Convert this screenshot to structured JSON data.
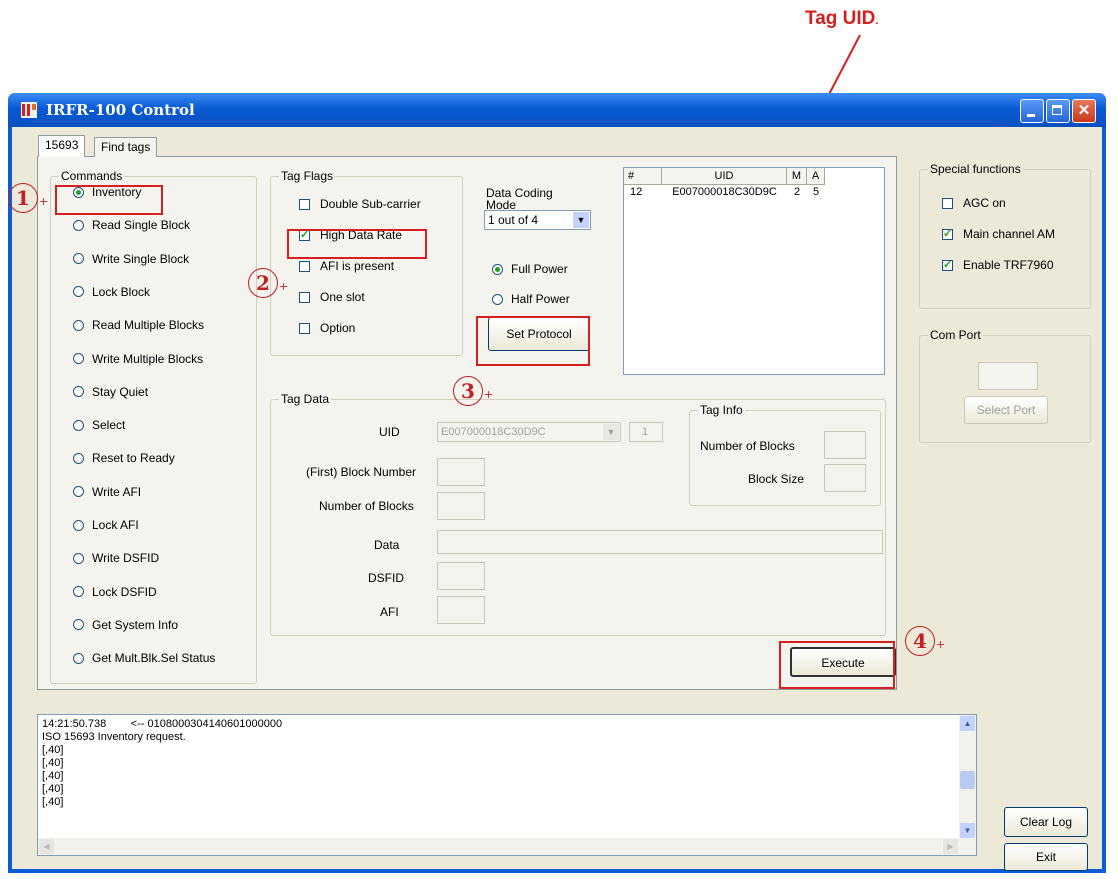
{
  "annotation": {
    "tag_uid_label": "Tag UID",
    "tag_uid_suffix": ".",
    "steps": [
      "1",
      "2",
      "3",
      "4"
    ],
    "step_mark": "+"
  },
  "window": {
    "title": "IRFR-100 Control"
  },
  "tabs": [
    {
      "label": "15693",
      "active": true
    },
    {
      "label": "Find tags",
      "active": false
    }
  ],
  "commands": {
    "legend": "Commands",
    "items": [
      {
        "label": "Inventory",
        "selected": true
      },
      {
        "label": "Read Single Block"
      },
      {
        "label": "Write Single Block"
      },
      {
        "label": "Lock Block"
      },
      {
        "label": "Read Multiple Blocks"
      },
      {
        "label": "Write Multiple Blocks"
      },
      {
        "label": "Stay Quiet"
      },
      {
        "label": "Select"
      },
      {
        "label": "Reset to Ready"
      },
      {
        "label": "Write AFI"
      },
      {
        "label": "Lock AFI"
      },
      {
        "label": "Write DSFID"
      },
      {
        "label": "Lock DSFID"
      },
      {
        "label": "Get System Info"
      },
      {
        "label": "Get Mult.Blk.Sel Status"
      }
    ]
  },
  "tag_flags": {
    "legend": "Tag Flags",
    "items": [
      {
        "label": "Double Sub-carrier",
        "checked": false
      },
      {
        "label": "High Data Rate",
        "checked": true
      },
      {
        "label": "AFI is present",
        "checked": false
      },
      {
        "label": "One slot",
        "checked": false
      },
      {
        "label": "Option",
        "checked": false
      }
    ]
  },
  "data_coding": {
    "label_line1": "Data Coding",
    "label_line2": "Mode",
    "selected": "1 out of 4",
    "power": [
      {
        "label": "Full Power",
        "selected": true
      },
      {
        "label": "Half Power",
        "selected": false
      }
    ],
    "set_protocol": "Set Protocol"
  },
  "uid_table": {
    "columns": [
      "#",
      "UID",
      "M",
      "A"
    ],
    "rows": [
      [
        "12",
        "E007000018C30D9C",
        "2",
        "5"
      ]
    ]
  },
  "special_functions": {
    "legend": "Special functions",
    "items": [
      {
        "label": "AGC on",
        "checked": false
      },
      {
        "label": "Main channel AM",
        "checked": true
      },
      {
        "label": "Enable TRF7960",
        "checked": true
      }
    ]
  },
  "com_port": {
    "legend": "Com Port",
    "select_port": "Select Port"
  },
  "tag_data": {
    "legend": "Tag Data",
    "uid_label": "UID",
    "uid_value": "E007000018C30D9C",
    "uid_index": "1",
    "first_block_label": "(First) Block Number",
    "num_blocks_label": "Number of Blocks",
    "data_label": "Data",
    "dsfid_label": "DSFID",
    "afi_label": "AFI",
    "tag_info": {
      "legend": "Tag Info",
      "num_blocks_label": "Number of Blocks",
      "block_size_label": "Block Size"
    }
  },
  "execute": "Execute",
  "log": {
    "lines": [
      "14:21:50.738        <-- 0108000304140601000000",
      "ISO 15693 Inventory request.",
      "[,40]",
      "[,40]",
      "[,40]",
      "[,40]",
      "[,40]"
    ]
  },
  "clear_log": "Clear Log",
  "exit": "Exit"
}
